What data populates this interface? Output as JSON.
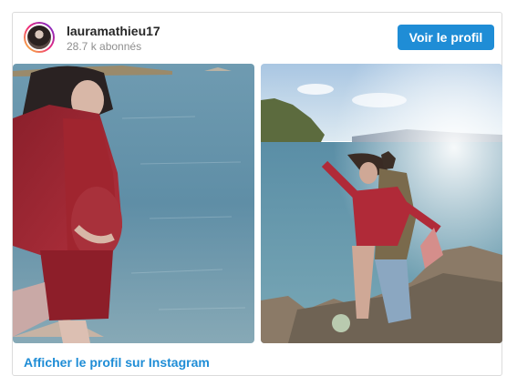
{
  "profile": {
    "username": "lauramathieu17",
    "followers": "28.7 k abonnés",
    "follow_label": "Voir le profil"
  },
  "footer": {
    "link_label": "Afficher le profil sur Instagram"
  },
  "icons": {
    "avatar": "profile-avatar"
  },
  "colors": {
    "accent": "#1f8dd6",
    "border": "#dbdbdb",
    "muted": "#8e8e8e"
  }
}
